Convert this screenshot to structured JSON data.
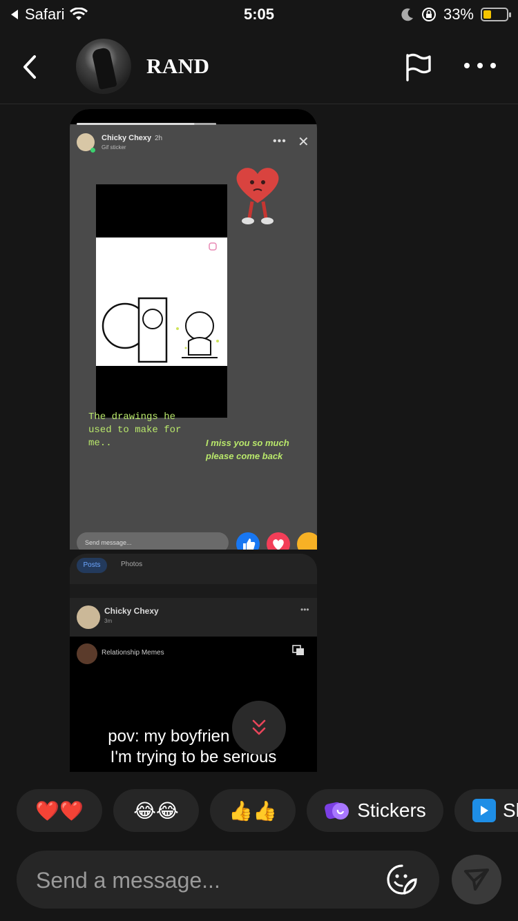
{
  "status_bar": {
    "carrier": "Safari",
    "time": "5:05",
    "battery": "33%",
    "battery_level": 0.33
  },
  "header": {
    "contact_name": "RAND"
  },
  "story": {
    "poster_name": "Chicky Chexy",
    "time": "2h",
    "subtitle": "Gif sticker",
    "caption_left": "The drawings he\nused to make for\nme..",
    "caption_right": "I miss you so much\nplease come back",
    "input_placeholder": "Send message..."
  },
  "post": {
    "tab_posts": "Posts",
    "tab_photos": "Photos",
    "poster_name": "Chicky Chexy",
    "time": "3m",
    "page_name": "Relationship Memes",
    "meme_line1": "pov: my boyfrien",
    "meme_line1_end": "n",
    "meme_line2": "I'm trying to be serious"
  },
  "quick_reactions": {
    "hearts": "❤️❤️",
    "laughs": "😂😂",
    "thumbs": "👍👍",
    "stickers_label": "Stickers",
    "next_label": "Sl"
  },
  "composer": {
    "placeholder": "Send a message..."
  },
  "colors": {
    "accent_send": "#3a3a3a",
    "story_text": "#b9e86b",
    "scroll_arrow": "#e8455a"
  }
}
